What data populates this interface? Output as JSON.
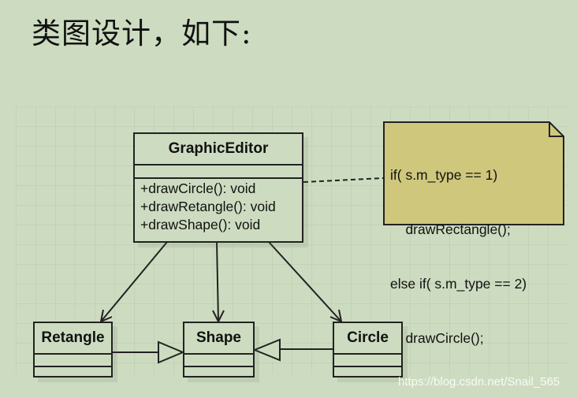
{
  "heading": "类图设计，如下:",
  "classes": {
    "graphic_editor": {
      "name": "GraphicEditor",
      "operations": [
        "+drawCircle(): void",
        "+drawRetangle(): void",
        "+drawShape(): void"
      ]
    },
    "retangle": {
      "name": "Retangle"
    },
    "shape": {
      "name": "Shape"
    },
    "circle": {
      "name": "Circle"
    }
  },
  "note": {
    "lines": [
      "if( s.m_type == 1)",
      "    drawRectangle();",
      "else if( s.m_type == 2)",
      "    drawCircle();"
    ]
  },
  "relations": [
    {
      "from": "GraphicEditor",
      "to": "Retangle",
      "type": "association"
    },
    {
      "from": "GraphicEditor",
      "to": "Shape",
      "type": "association"
    },
    {
      "from": "GraphicEditor",
      "to": "Circle",
      "type": "association"
    },
    {
      "from": "Retangle",
      "to": "Shape",
      "type": "generalization"
    },
    {
      "from": "Circle",
      "to": "Shape",
      "type": "generalization"
    },
    {
      "from": "GraphicEditor",
      "to": "note",
      "type": "note-link"
    }
  ],
  "colors": {
    "background": "#cddcc0",
    "note_fill": "#cfc77c",
    "line": "#222222"
  },
  "watermark": "https://blog.csdn.net/Snail_565"
}
